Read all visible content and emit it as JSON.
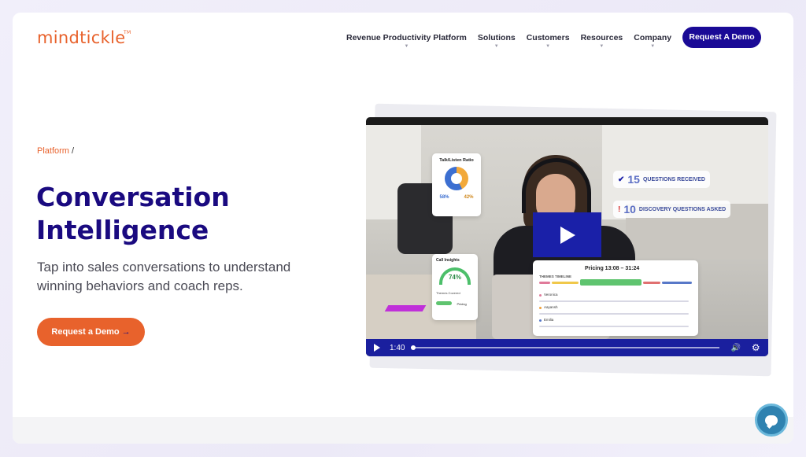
{
  "brand": {
    "name": "mindtickle",
    "tm": "TM",
    "color": "#e8622c"
  },
  "nav": {
    "items": [
      {
        "label": "Revenue Productivity Platform"
      },
      {
        "label": "Solutions"
      },
      {
        "label": "Customers"
      },
      {
        "label": "Resources"
      },
      {
        "label": "Company"
      }
    ],
    "cta": "Request A Demo"
  },
  "hero": {
    "breadcrumb_link": "Platform",
    "breadcrumb_sep": " /",
    "title_line1": "Conversation",
    "title_line2": "Intelligence",
    "subtitle": "Tap into sales conversations to understand winning behaviors and coach reps.",
    "cta": "Request a Demo",
    "cta_arrow": "→"
  },
  "video": {
    "overlay": {
      "talk_listen_title": "Talk/Listen Ratio",
      "talk_pct": "58%",
      "listen_pct": "42%",
      "talk_share": 0.58,
      "listen_share": 0.42,
      "call_insights_title": "Call Insights",
      "call_score": "74%",
      "call_score_value": 0.74,
      "themes_covered": "Themes Covered",
      "theme_chip": "Pricing",
      "questions_received_num": "15",
      "questions_received_label": "QUESTIONS RECEIVED",
      "discovery_questions_num": "10",
      "discovery_questions_label": "DISCOVERY QUESTIONS ASKED",
      "pricing_label": "Pricing 13:08 – 31:24",
      "themes_timeline": "THEMES TIMELINE",
      "speakers": [
        "Veronica",
        "Aayansh",
        "Emilia"
      ]
    },
    "controls": {
      "time": "1:40",
      "progress": 0.0
    },
    "colors": {
      "control_bar": "#1a1f9e",
      "play_button": "#1a20a8"
    }
  },
  "colors": {
    "primary": "#1a0a80",
    "accent": "#e8622c",
    "cta_dark": "#1a0a96"
  }
}
